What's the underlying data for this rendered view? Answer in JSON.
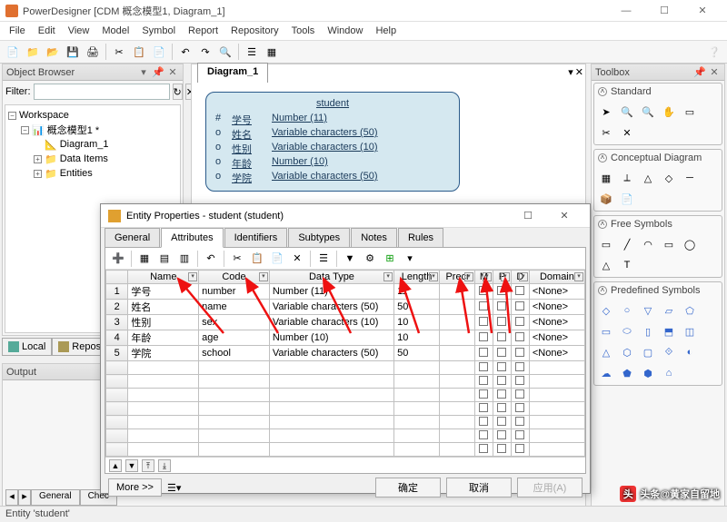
{
  "window": {
    "title": "PowerDesigner [CDM 概念模型1, Diagram_1]"
  },
  "menu": [
    "File",
    "Edit",
    "View",
    "Model",
    "Symbol",
    "Report",
    "Repository",
    "Tools",
    "Window",
    "Help"
  ],
  "browser": {
    "title": "Object Browser",
    "filter_label": "Filter:",
    "tree": {
      "root": "Workspace",
      "model": "概念模型1 *",
      "items": [
        "Diagram_1",
        "Data Items",
        "Entities"
      ]
    },
    "tabs": [
      "Local",
      "Reposi"
    ]
  },
  "diagram": {
    "tab": "Diagram_1",
    "entity": {
      "name": "student",
      "attrs": [
        {
          "mark": "#",
          "label": "学号",
          "type": "Number (11)"
        },
        {
          "mark": "o",
          "label": "姓名",
          "type": "Variable characters (50)"
        },
        {
          "mark": "o",
          "label": "性别",
          "type": "Variable characters (10)"
        },
        {
          "mark": "o",
          "label": "年龄",
          "type": "Number (10)"
        },
        {
          "mark": "o",
          "label": "学院",
          "type": "Variable characters (50)"
        }
      ]
    }
  },
  "toolbox": {
    "title": "Toolbox",
    "groups": [
      "Standard",
      "Conceptual Diagram",
      "Free Symbols",
      "Predefined Symbols"
    ]
  },
  "output": {
    "title": "Output"
  },
  "dialog": {
    "title": "Entity Properties - student (student)",
    "tabs": [
      "General",
      "Attributes",
      "Identifiers",
      "Subtypes",
      "Notes",
      "Rules"
    ],
    "active_tab": "Attributes",
    "columns": [
      "Name",
      "Code",
      "Data Type",
      "Length",
      "Preci",
      "M",
      "P",
      "D",
      "Domain"
    ],
    "rows": [
      {
        "n": "1",
        "name": "学号",
        "code": "number",
        "datatype": "Number (11)",
        "length": "11",
        "domain": "<None>"
      },
      {
        "n": "2",
        "name": "姓名",
        "code": "name",
        "datatype": "Variable characters (50)",
        "length": "50",
        "domain": "<None>"
      },
      {
        "n": "3",
        "name": "性别",
        "code": "sex",
        "datatype": "Variable characters (10)",
        "length": "10",
        "domain": "<None>"
      },
      {
        "n": "4",
        "name": "年龄",
        "code": "age",
        "datatype": "Number (10)",
        "length": "10",
        "domain": "<None>"
      },
      {
        "n": "5",
        "name": "学院",
        "code": "school",
        "datatype": "Variable characters (50)",
        "length": "50",
        "domain": "<None>"
      }
    ],
    "buttons": {
      "more": "More >>",
      "ok": "确定",
      "cancel": "取消",
      "apply": "应用(A)"
    }
  },
  "bottom_tabs": [
    "General",
    "Chec"
  ],
  "status": "Entity 'student'",
  "watermark": "头条@黄家自留地"
}
